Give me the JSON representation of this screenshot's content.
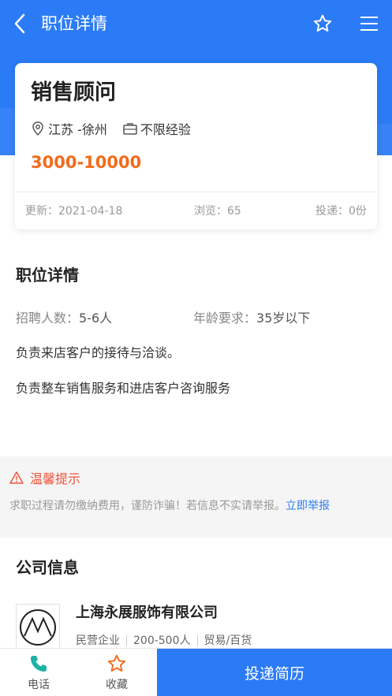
{
  "header": {
    "title": "职位详情",
    "back_icon": "chevron-left-icon",
    "favorite_icon": "star-outline-icon",
    "menu_icon": "hamburger-menu-icon"
  },
  "job": {
    "title": "销售顾问",
    "location": "江苏 -徐州",
    "experience": "不限经验",
    "salary": "3000-10000",
    "updated": "更新：2021-04-18",
    "views": "浏览：65",
    "applications": "投递：0份"
  },
  "details": {
    "section_title": "职位详情",
    "headcount_label": "招聘人数：",
    "headcount_value": "5-6人",
    "age_label": "年龄要求：",
    "age_value": "35岁以下",
    "desc_lines": [
      "负责来店客户的接待与洽谈。",
      "负责整车销售服务和进店客户咨询服务"
    ]
  },
  "tip": {
    "title": "温馨提示",
    "text": "求职过程请勿缴纳费用，谨防诈骗！若信息不实请举报。",
    "link": "立即举报"
  },
  "company": {
    "section_title": "公司信息",
    "name": "上海永展服饰有限公司",
    "type": "民营企业",
    "size": "200-500人",
    "industry": "贸易/百货"
  },
  "bottom_bar": {
    "phone_label": "电话",
    "favorite_label": "收藏",
    "apply_label": "投递简历"
  },
  "colors": {
    "brand_blue": "#2b7bf6",
    "salary_orange": "#f26b1d",
    "warning_red": "#f0533b",
    "phone_teal": "#1bb3a6"
  }
}
